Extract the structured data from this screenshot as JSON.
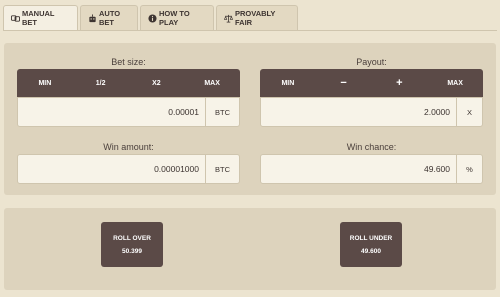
{
  "tabs": [
    {
      "label": "MANUAL BET",
      "icon": "dice-icon"
    },
    {
      "label": "AUTO BET",
      "icon": "robot-icon"
    },
    {
      "label": "HOW TO PLAY",
      "icon": "info-icon"
    },
    {
      "label": "PROVABLY FAIR",
      "icon": "scales-icon"
    }
  ],
  "bet": {
    "label": "Bet size:",
    "buttons": [
      "MIN",
      "1/2",
      "X2",
      "MAX"
    ],
    "value": "0.00001",
    "unit": "BTC"
  },
  "payout": {
    "label": "Payout:",
    "buttons": [
      "MIN",
      "−",
      "+",
      "MAX"
    ],
    "value": "2.0000",
    "unit": "X"
  },
  "win_amount": {
    "label": "Win amount:",
    "value": "0.00001000",
    "unit": "BTC"
  },
  "win_chance": {
    "label": "Win chance:",
    "value": "49.600",
    "unit": "%"
  },
  "roll_over": {
    "label": "ROLL OVER",
    "value": "50.399"
  },
  "roll_under": {
    "label": "ROLL UNDER",
    "value": "49.600"
  }
}
